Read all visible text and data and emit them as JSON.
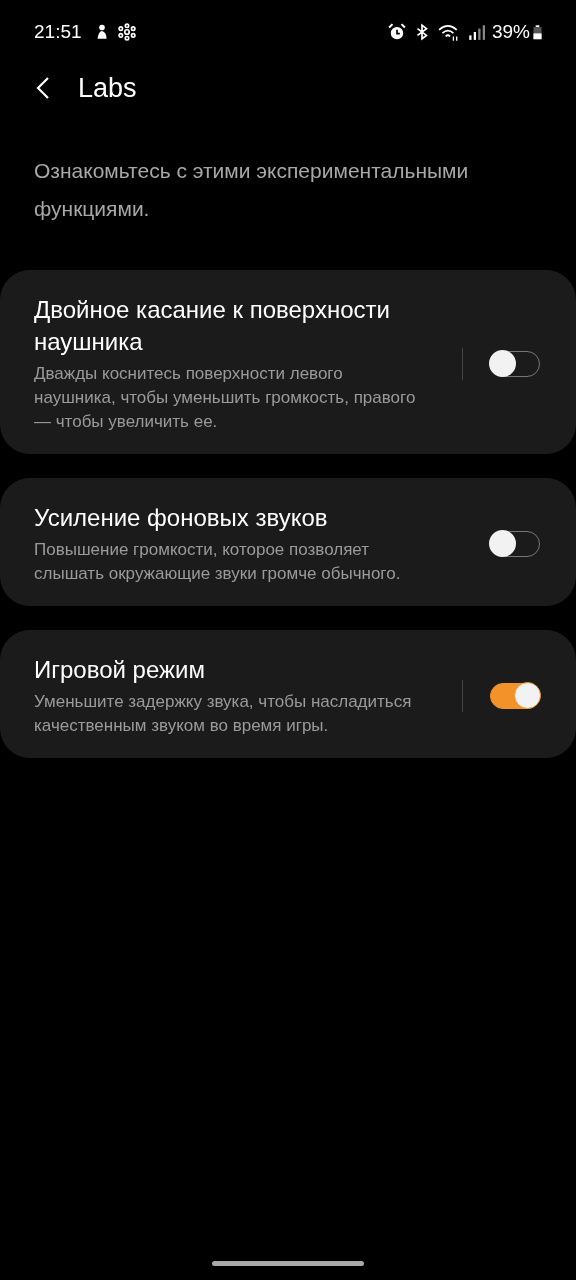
{
  "status_bar": {
    "time": "21:51",
    "battery": "39%"
  },
  "header": {
    "title": "Labs"
  },
  "intro": "Ознакомьтесь с этими экспериментальными функциями.",
  "features": [
    {
      "title": "Двойное касание к поверхности наушника",
      "description": "Дважды коснитесь поверхности левого наушника, чтобы уменьшить громкость, правого — чтобы увеличить ее.",
      "on": false,
      "divider": true
    },
    {
      "title": "Усиление фоновых звуков",
      "description": "Повышение громкости, которое позволяет слышать окружающие звуки громче обычного.",
      "on": false,
      "divider": false
    },
    {
      "title": "Игровой режим",
      "description": "Уменьшите задержку звука, чтобы насладиться качественным звуком во время игры.",
      "on": true,
      "divider": true
    }
  ]
}
